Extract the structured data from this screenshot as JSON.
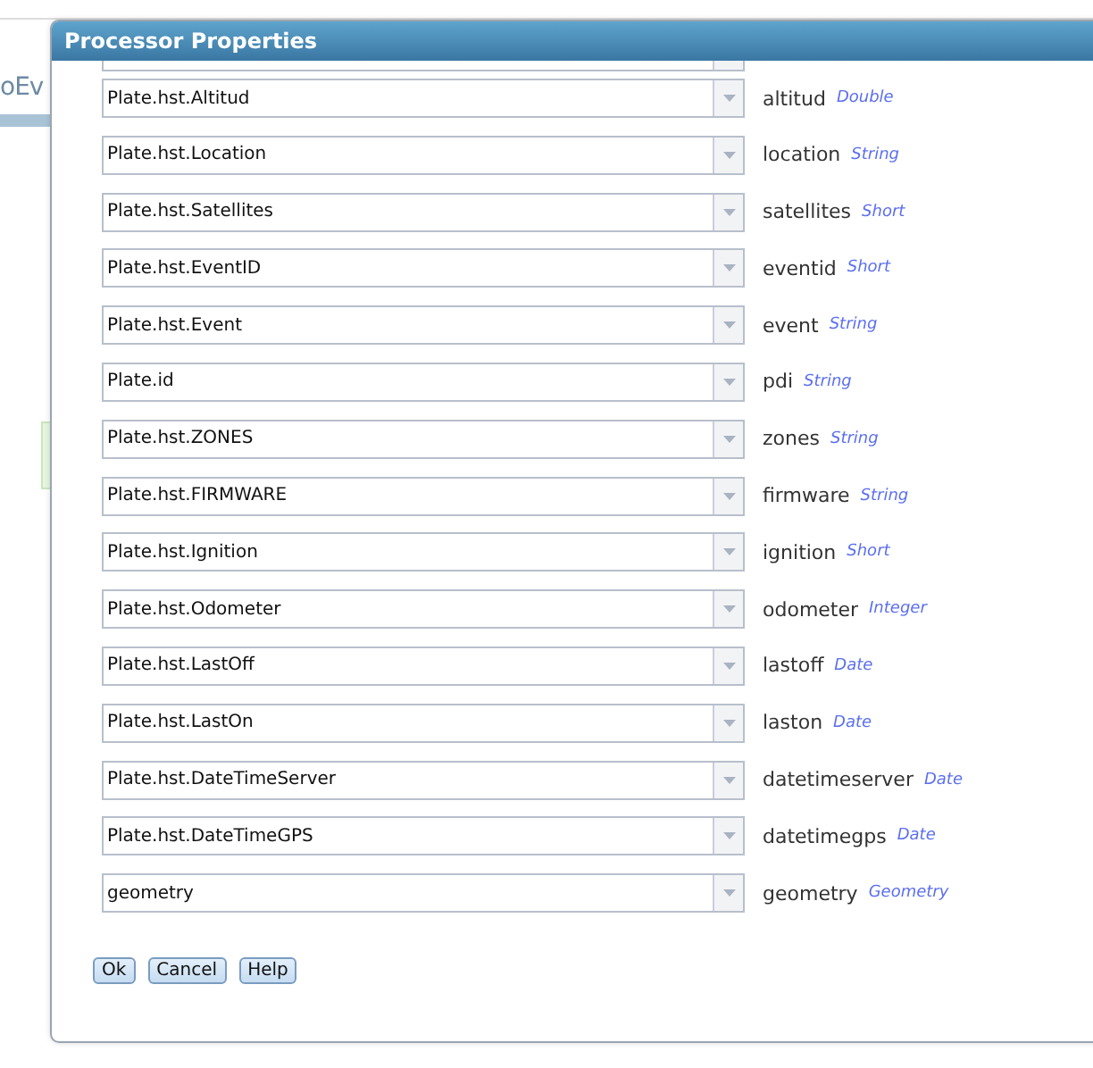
{
  "background": {
    "tab_text": "oEv"
  },
  "dialog": {
    "title": "Processor Properties",
    "rows": [
      {
        "value": "Plate.hst.Altitud",
        "name": "altitud",
        "type": "Double"
      },
      {
        "value": "Plate.hst.Location",
        "name": "location",
        "type": "String"
      },
      {
        "value": "Plate.hst.Satellites",
        "name": "satellites",
        "type": "Short"
      },
      {
        "value": "Plate.hst.EventID",
        "name": "eventid",
        "type": "Short"
      },
      {
        "value": "Plate.hst.Event",
        "name": "event",
        "type": "String"
      },
      {
        "value": "Plate.id",
        "name": "pdi",
        "type": "String"
      },
      {
        "value": "Plate.hst.ZONES",
        "name": "zones",
        "type": "String"
      },
      {
        "value": "Plate.hst.FIRMWARE",
        "name": "firmware",
        "type": "String"
      },
      {
        "value": "Plate.hst.Ignition",
        "name": "ignition",
        "type": "Short"
      },
      {
        "value": "Plate.hst.Odometer",
        "name": "odometer",
        "type": "Integer"
      },
      {
        "value": "Plate.hst.LastOff",
        "name": "lastoff",
        "type": "Date"
      },
      {
        "value": "Plate.hst.LastOn",
        "name": "laston",
        "type": "Date"
      },
      {
        "value": "Plate.hst.DateTimeServer",
        "name": "datetimeserver",
        "type": "Date"
      },
      {
        "value": "Plate.hst.DateTimeGPS",
        "name": "datetimegps",
        "type": "Date"
      },
      {
        "value": "geometry",
        "name": "geometry",
        "type": "Geometry"
      }
    ],
    "buttons": [
      "Ok",
      "Cancel",
      "Help"
    ]
  }
}
